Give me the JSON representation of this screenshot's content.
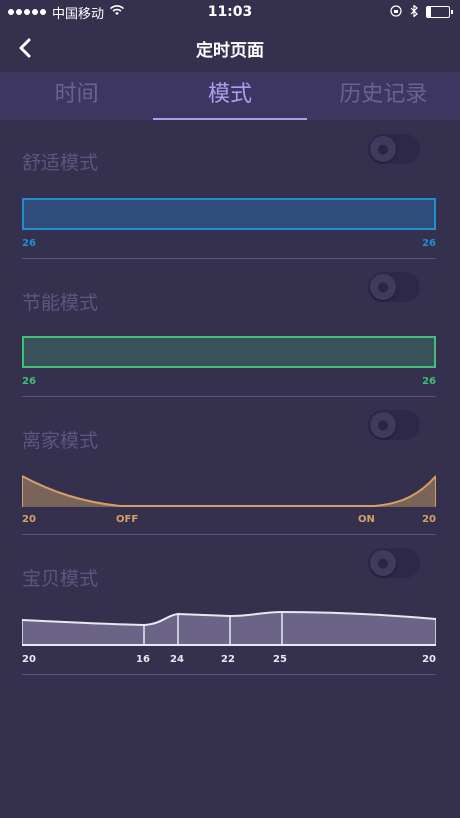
{
  "status_bar": {
    "carrier": "中国移动",
    "time": "11:03"
  },
  "nav": {
    "title": "定时页面"
  },
  "tabs": [
    {
      "label": "时间",
      "active": false
    },
    {
      "label": "模式",
      "active": true
    },
    {
      "label": "历史记录",
      "active": false
    }
  ],
  "modes": [
    {
      "title": "舒适模式",
      "enabled": false,
      "color": "#1d8fd4",
      "labels": [
        "26",
        "26"
      ]
    },
    {
      "title": "节能模式",
      "enabled": false,
      "color": "#3dbf75",
      "labels": [
        "26",
        "26"
      ]
    },
    {
      "title": "离家模式",
      "enabled": false,
      "color": "#d6a064",
      "labels": [
        "20",
        "OFF",
        "ON",
        "20"
      ]
    },
    {
      "title": "宝贝模式",
      "enabled": false,
      "color": "#ffffff",
      "labels": [
        "20",
        "16",
        "24",
        "22",
        "25",
        "20"
      ]
    }
  ]
}
